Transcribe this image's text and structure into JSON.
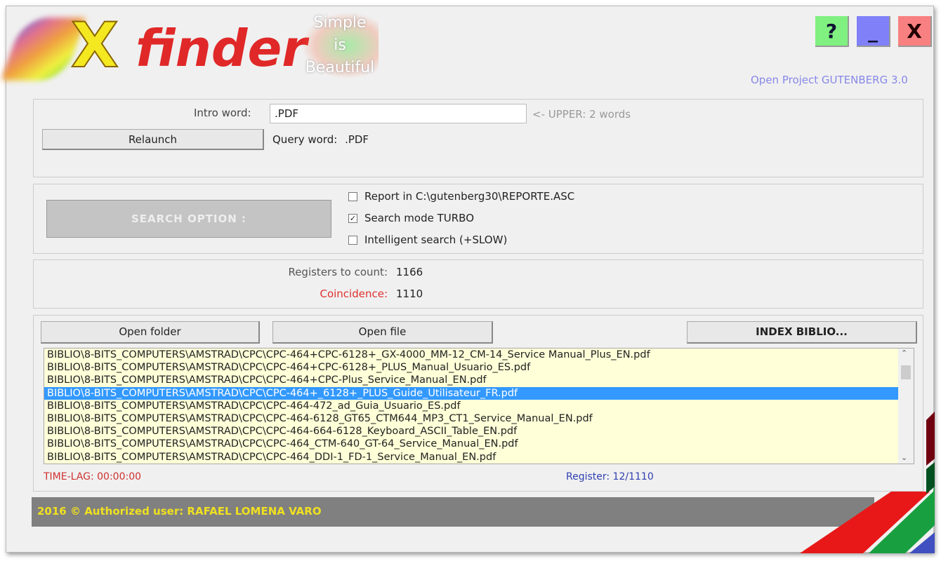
{
  "app": {
    "logo_x": "X",
    "logo_finder": "finder",
    "slogan": [
      "Simple",
      "is",
      "Beautiful"
    ],
    "subtitle": "Open Project GUTENBERG 3.0"
  },
  "window_buttons": {
    "help": "?",
    "minimize": "_",
    "close": "X"
  },
  "query": {
    "intro_label": "Intro word:",
    "intro_value": ".PDF",
    "hint": "<- UPPER: 2 words",
    "relaunch": "Relaunch",
    "query_label": "Query word:",
    "query_value": ".PDF"
  },
  "options": {
    "search_option": "SEARCH OPTION :",
    "items": [
      {
        "label": "Report in C:\\gutenberg30\\REPORTE.ASC",
        "checked": false
      },
      {
        "label": "Search mode TURBO",
        "checked": true
      },
      {
        "label": "Intelligent search (+SLOW)",
        "checked": false
      }
    ]
  },
  "counts": {
    "registers_label": "Registers to count:",
    "registers_value": "1166",
    "coincidence_label": "Coincidence:",
    "coincidence_value": "1110"
  },
  "results": {
    "open_folder": "Open folder",
    "open_file": "Open file",
    "index": "INDEX BIBLIO...",
    "selected_index": 3,
    "rows": [
      "BIBLIO\\8-BITS_COMPUTERS\\AMSTRAD\\CPC\\CPC-464+CPC-6128+_GX-4000_MM-12_CM-14_Service Manual_Plus_EN.pdf",
      "BIBLIO\\8-BITS_COMPUTERS\\AMSTRAD\\CPC\\CPC-464+CPC-6128+_PLUS_Manual_Usuario_ES.pdf",
      "BIBLIO\\8-BITS_COMPUTERS\\AMSTRAD\\CPC\\CPC-464+CPC-Plus_Service_Manual_EN.pdf",
      "BIBLIO\\8-BITS_COMPUTERS\\AMSTRAD\\CPC\\CPC-464+_6128+_PLUS_Guide_Utilisateur_FR.pdf",
      "BIBLIO\\8-BITS_COMPUTERS\\AMSTRAD\\CPC\\CPC-464-472_ad_Guia_Usuario_ES.pdf",
      "BIBLIO\\8-BITS_COMPUTERS\\AMSTRAD\\CPC\\CPC-464-6128_GT65_CTM644_MP3_CT1_Service_Manual_EN.pdf",
      "BIBLIO\\8-BITS_COMPUTERS\\AMSTRAD\\CPC\\CPC-464-664-6128_Keyboard_ASCII_Table_EN.pdf",
      "BIBLIO\\8-BITS_COMPUTERS\\AMSTRAD\\CPC\\CPC-464_CTM-640_GT-64_Service_Manual_EN.pdf",
      "BIBLIO\\8-BITS_COMPUTERS\\AMSTRAD\\CPC\\CPC-464_DDI-1_FD-1_Service_Manual_EN.pdf"
    ],
    "time_lag": "TIME-LAG: 00:00:00",
    "register": "Register: 12/1110"
  },
  "footer": {
    "text": "2016 © Authorized user: RAFAEL LOMENA VARO"
  },
  "colors": {
    "help": "#80f080",
    "minimize": "#8080f8",
    "close": "#f88080",
    "selection": "#3399ff",
    "list_bg": "#ffffd8",
    "footer_bar": "#808080",
    "footer_text": "#f0e020"
  }
}
